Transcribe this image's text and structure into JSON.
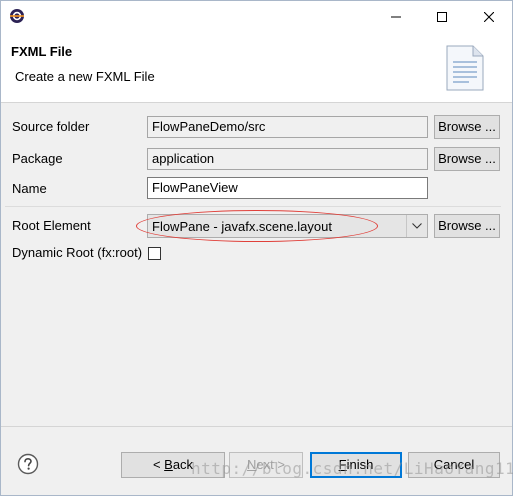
{
  "window": {
    "app_icon": "eclipse-icon",
    "controls": {
      "minimize": "minimize-icon",
      "maximize": "maximize-icon",
      "close": "close-icon"
    }
  },
  "header": {
    "title": "FXML File",
    "subtitle": "Create a new FXML File",
    "icon": "new-file-wizard-icon"
  },
  "form": {
    "source_folder": {
      "label": "Source folder",
      "value": "FlowPaneDemo/src",
      "browse": "Browse ..."
    },
    "package": {
      "label": "Package",
      "value": "application",
      "browse": "Browse ..."
    },
    "name": {
      "label": "Name",
      "value": "FlowPaneView"
    },
    "root_element": {
      "label": "Root Element",
      "value": "FlowPane - javafx.scene.layout",
      "browse": "Browse ..."
    },
    "dynamic_root": {
      "label": "Dynamic Root (fx:root)",
      "checked": false
    }
  },
  "footer": {
    "help_icon": "help-icon",
    "back": {
      "prefix": "< ",
      "mnemonic": "B",
      "rest": "ack"
    },
    "next": {
      "mnemonic": "N",
      "rest": "ext >"
    },
    "finish": {
      "mnemonic": "F",
      "rest": "inish"
    },
    "cancel": "Cancel"
  },
  "watermark": "http://blog.csdn.net/LiHaoYang11",
  "colors": {
    "annotation_ellipse": "#e0403a",
    "default_button_border": "#0078d7"
  }
}
